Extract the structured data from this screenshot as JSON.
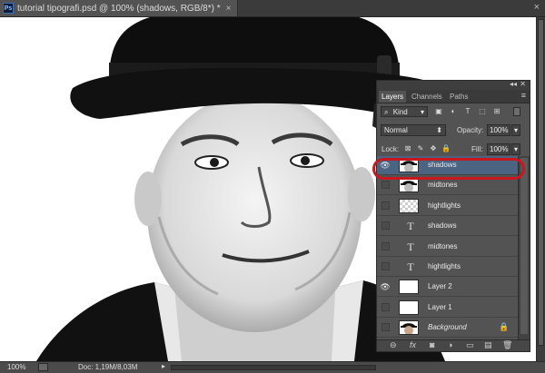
{
  "document": {
    "ps_badge": "Ps",
    "title": "tutorial tipografi.psd @ 100% (shadows, RGB/8*) *",
    "tab_close": "×",
    "window_close": "×"
  },
  "status": {
    "zoom": "100%",
    "doc": "Doc: 1,19M/8,03M",
    "arrow": "▸"
  },
  "layers_panel": {
    "collapse": "◂◂",
    "close": "✕",
    "tabs": [
      "Layers",
      "Channels",
      "Paths"
    ],
    "active_tab": "Layers",
    "menu": "≡",
    "filter": {
      "label": "Kind",
      "icon": "search-icon",
      "caret": "▾"
    },
    "filter_icons": [
      "▣",
      "◐",
      "T",
      "⬚",
      "⊞"
    ],
    "blend_mode": "Normal",
    "blend_caret": "⬍",
    "opacity_label": "Opacity:",
    "opacity_value": "100%",
    "lock_label": "Lock:",
    "lock_icons": [
      "⊠",
      "✎",
      "✥",
      "🔒"
    ],
    "fill_label": "Fill:",
    "fill_value": "100%",
    "dropdown_caret": "▾",
    "layers": [
      {
        "name": "shadows",
        "kind": "image",
        "visible": true,
        "selected": true
      },
      {
        "name": "midtones",
        "kind": "image",
        "visible": false,
        "selected": false
      },
      {
        "name": "hightlights",
        "kind": "checker",
        "visible": false,
        "selected": false
      },
      {
        "name": "shadows",
        "kind": "text",
        "visible": false,
        "selected": false
      },
      {
        "name": "midtones",
        "kind": "text",
        "visible": false,
        "selected": false
      },
      {
        "name": "hightlights",
        "kind": "text",
        "visible": false,
        "selected": false
      },
      {
        "name": "Layer 2",
        "kind": "white",
        "visible": true,
        "selected": false
      },
      {
        "name": "Layer 1",
        "kind": "white",
        "visible": false,
        "selected": false
      },
      {
        "name": "Background",
        "kind": "photo",
        "visible": false,
        "selected": false,
        "locked": true
      }
    ],
    "text_glyph": "T",
    "eye_glyph": "👁",
    "lock_glyph": "🔒",
    "footer_icons": [
      "⊖",
      "fx",
      "◙",
      "◑",
      "▭",
      "▤",
      "🗑"
    ]
  },
  "colors": {
    "selection": "#4a6482",
    "highlight_ring": "#c8171e",
    "panel_bg": "#535353"
  }
}
